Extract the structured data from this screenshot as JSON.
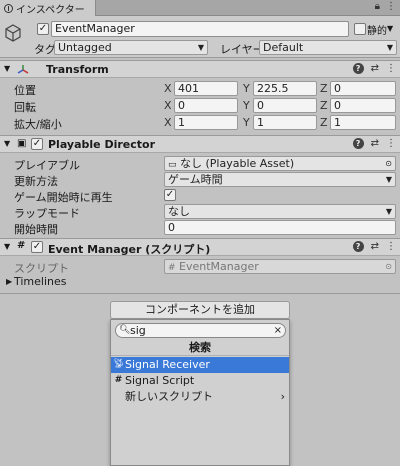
{
  "tab": {
    "title": "インスペクター"
  },
  "header": {
    "object_name": "EventManager",
    "static_label": "静的",
    "tag_label": "タグ",
    "tag_value": "Untagged",
    "layer_label": "レイヤー",
    "layer_value": "Default"
  },
  "transform": {
    "title": "Transform",
    "rows": [
      {
        "label": "位置",
        "x": "401",
        "y": "225.5",
        "z": "0"
      },
      {
        "label": "回転",
        "x": "0",
        "y": "0",
        "z": "0"
      },
      {
        "label": "拡大/縮小",
        "x": "1",
        "y": "1",
        "z": "1"
      }
    ],
    "axis": {
      "x": "X",
      "y": "Y",
      "z": "Z"
    }
  },
  "playable": {
    "title": "Playable Director",
    "rows": [
      {
        "label": "プレイアブル",
        "value": "なし (Playable Asset)"
      },
      {
        "label": "更新方法",
        "value": "ゲーム時間"
      },
      {
        "label": "ゲーム開始時に再生",
        "value": ""
      },
      {
        "label": "ラップモード",
        "value": "なし"
      },
      {
        "label": "開始時間",
        "value": "0"
      }
    ]
  },
  "eventmanager": {
    "title": "Event Manager (スクリプト)",
    "script_label": "スクリプト",
    "script_value": "EventManager",
    "timelines_label": "Timelines"
  },
  "add_component_label": "コンポーネントを追加",
  "popup": {
    "search_value": "sig",
    "title": "検索",
    "items": [
      {
        "label": "Signal Receiver"
      },
      {
        "label": "Signal Script"
      },
      {
        "label": "新しいスクリプト"
      }
    ]
  }
}
